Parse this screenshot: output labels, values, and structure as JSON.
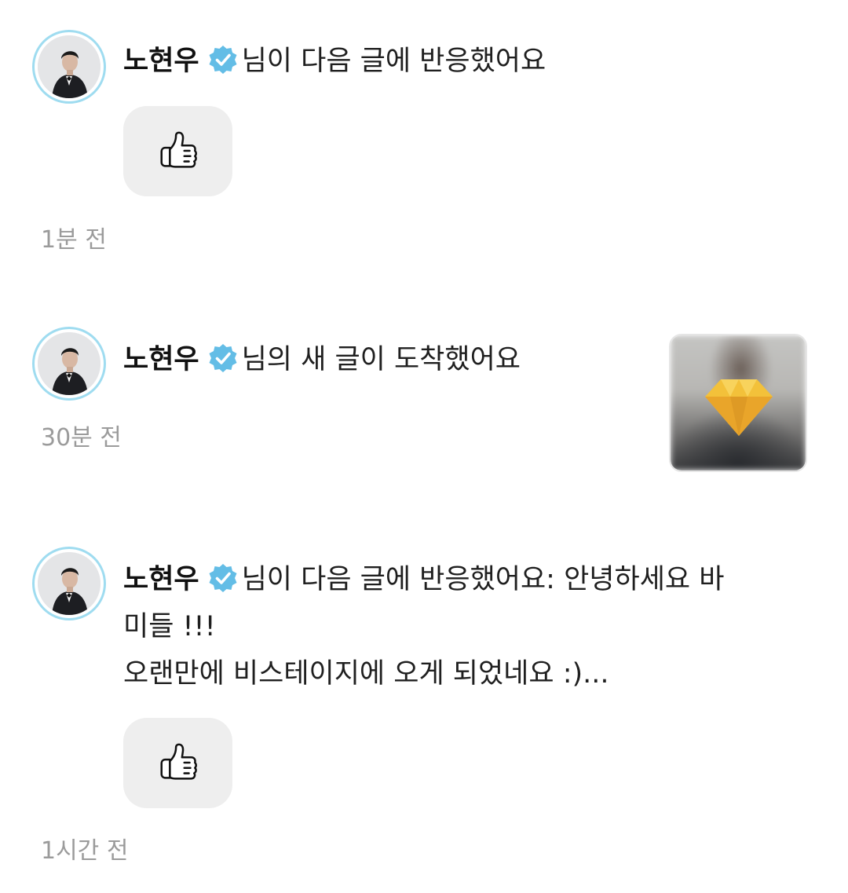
{
  "notifications": [
    {
      "user": "노현우",
      "message": "님이 다음 글에 반응했어요",
      "reaction_icon": "thumbs-up-icon",
      "time": "1분 전"
    },
    {
      "user": "노현우",
      "message": "님의 새 글이 도착했어요",
      "thumbnail_icon": "gem-icon",
      "time": "30분 전"
    },
    {
      "user": "노현우",
      "message_line1": "님이 다음 글에 반응했어요: 안녕하세요 바",
      "message_line2": "미들 !!!",
      "message_line3": "오랜만에 비스테이지에 오게 되었네요 :)...",
      "reaction_icon": "thumbs-up-icon",
      "time": "1시간 전"
    }
  ],
  "colors": {
    "avatar_ring": "#9fdcf0",
    "verified_badge": "#63bde6",
    "reaction_bg": "#eeeeee",
    "timestamp": "#9b9b9b",
    "gem": "#f3c13a"
  }
}
